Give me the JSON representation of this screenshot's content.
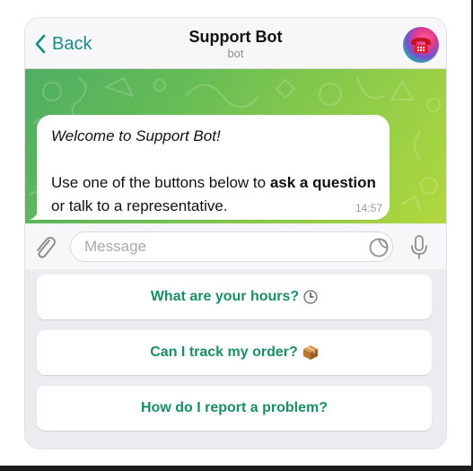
{
  "header": {
    "back_label": "Back",
    "title": "Support Bot",
    "subtitle": "bot",
    "avatar_icon": "telephone-icon"
  },
  "message": {
    "line1": "Welcome to Support Bot!",
    "line2_pre": "Use one of the buttons below to ",
    "line2_bold": "ask a question",
    "line2_post": " or talk to a representative.",
    "time": "14:57"
  },
  "composer": {
    "placeholder": "Message",
    "attach_icon": "paperclip-icon",
    "sticker_icon": "sticker-icon",
    "mic_icon": "microphone-icon"
  },
  "keyboard": {
    "buttons": [
      {
        "label": "What are your hours?",
        "icon": "clock-icon"
      },
      {
        "label": "Can I track my order?",
        "icon": "package-icon"
      },
      {
        "label": "How do I report a problem?",
        "icon": ""
      }
    ]
  },
  "colors": {
    "accent": "#1a8e86",
    "button_text": "#1a8e64",
    "chat_bg_start": "#4fae63",
    "chat_bg_end": "#b2d83d"
  }
}
